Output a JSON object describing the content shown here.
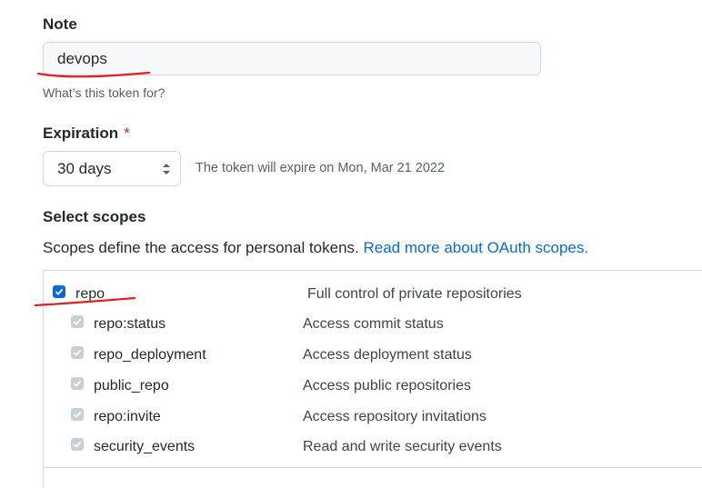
{
  "note": {
    "label": "Note",
    "value": "devops",
    "hint": "What’s this token for?"
  },
  "expiration": {
    "label": "Expiration",
    "required_mark": "*",
    "selected": "30 days",
    "note": "The token will expire on Mon, Mar 21 2022"
  },
  "scopes": {
    "heading": "Select scopes",
    "description": "Scopes define the access for personal tokens.",
    "link_text": "Read more about OAuth scopes.",
    "parent": {
      "name": "repo",
      "description": "Full control of private repositories",
      "checked": true
    },
    "children": [
      {
        "name": "repo:status",
        "description": "Access commit status",
        "checked": true
      },
      {
        "name": "repo_deployment",
        "description": "Access deployment status",
        "checked": true
      },
      {
        "name": "public_repo",
        "description": "Access public repositories",
        "checked": true
      },
      {
        "name": "repo:invite",
        "description": "Access repository invitations",
        "checked": true
      },
      {
        "name": "security_events",
        "description": "Read and write security events",
        "checked": true
      }
    ]
  },
  "colors": {
    "link": "#0969da",
    "checkbox": "#0969da",
    "annotation": "#e02020",
    "required": "#cf222e"
  }
}
